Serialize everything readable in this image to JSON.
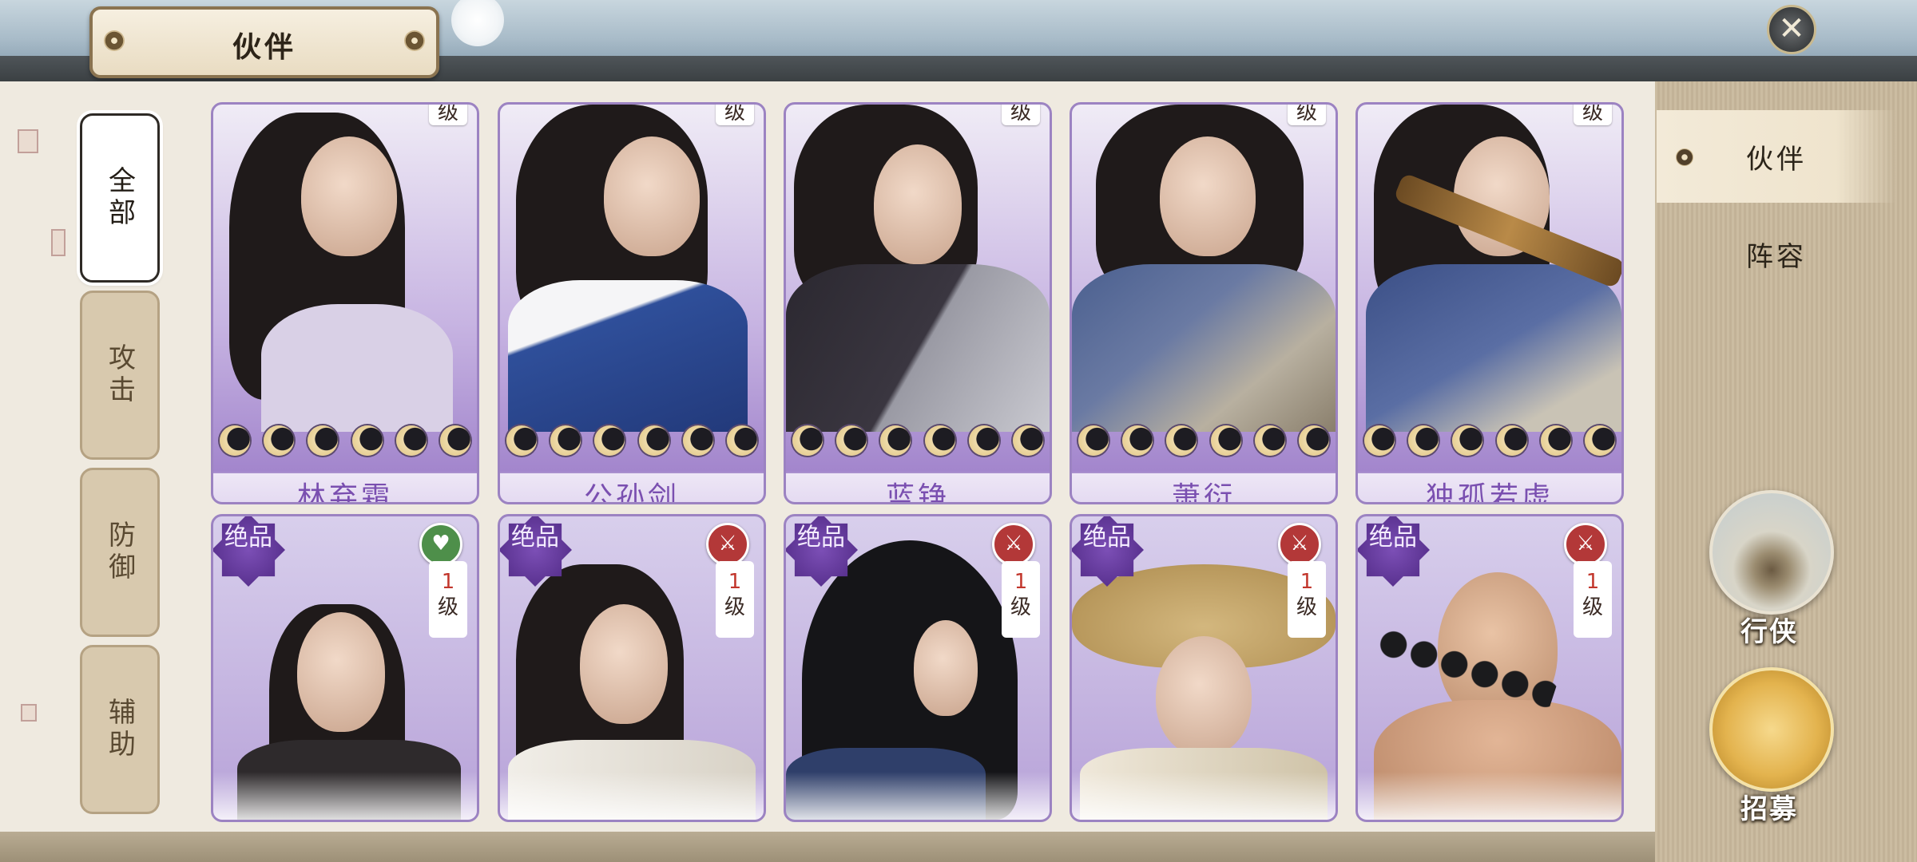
{
  "header": {
    "title": "伙伴",
    "close_icon": "close-icon"
  },
  "filters": [
    {
      "label": "全部",
      "active": true
    },
    {
      "label": "攻击",
      "active": false
    },
    {
      "label": "防御",
      "active": false
    },
    {
      "label": "辅助",
      "active": false
    }
  ],
  "level_unit": "级",
  "rarity_badge": "绝品",
  "row1": [
    {
      "name": "林弃霜",
      "stars": 6
    },
    {
      "name": "公孙剑",
      "stars": 6
    },
    {
      "name": "蓝铮",
      "stars": 6
    },
    {
      "name": "萧衍",
      "stars": 6
    },
    {
      "name": "独孤若虚",
      "stars": 6
    }
  ],
  "row2": [
    {
      "level": "1",
      "role": "heal"
    },
    {
      "level": "1",
      "role": "attack"
    },
    {
      "level": "1",
      "role": "attack"
    },
    {
      "level": "1",
      "role": "attack"
    },
    {
      "level": "1",
      "role": "attack"
    }
  ],
  "nav": {
    "partner": "伙伴",
    "lineup": "阵容"
  },
  "side_buttons": {
    "xingxia": "行侠",
    "zhaomu": "招募"
  },
  "colors": {
    "accent": "#7a4fb0",
    "card_border": "#9c83c2",
    "level_red": "#c2362c"
  }
}
